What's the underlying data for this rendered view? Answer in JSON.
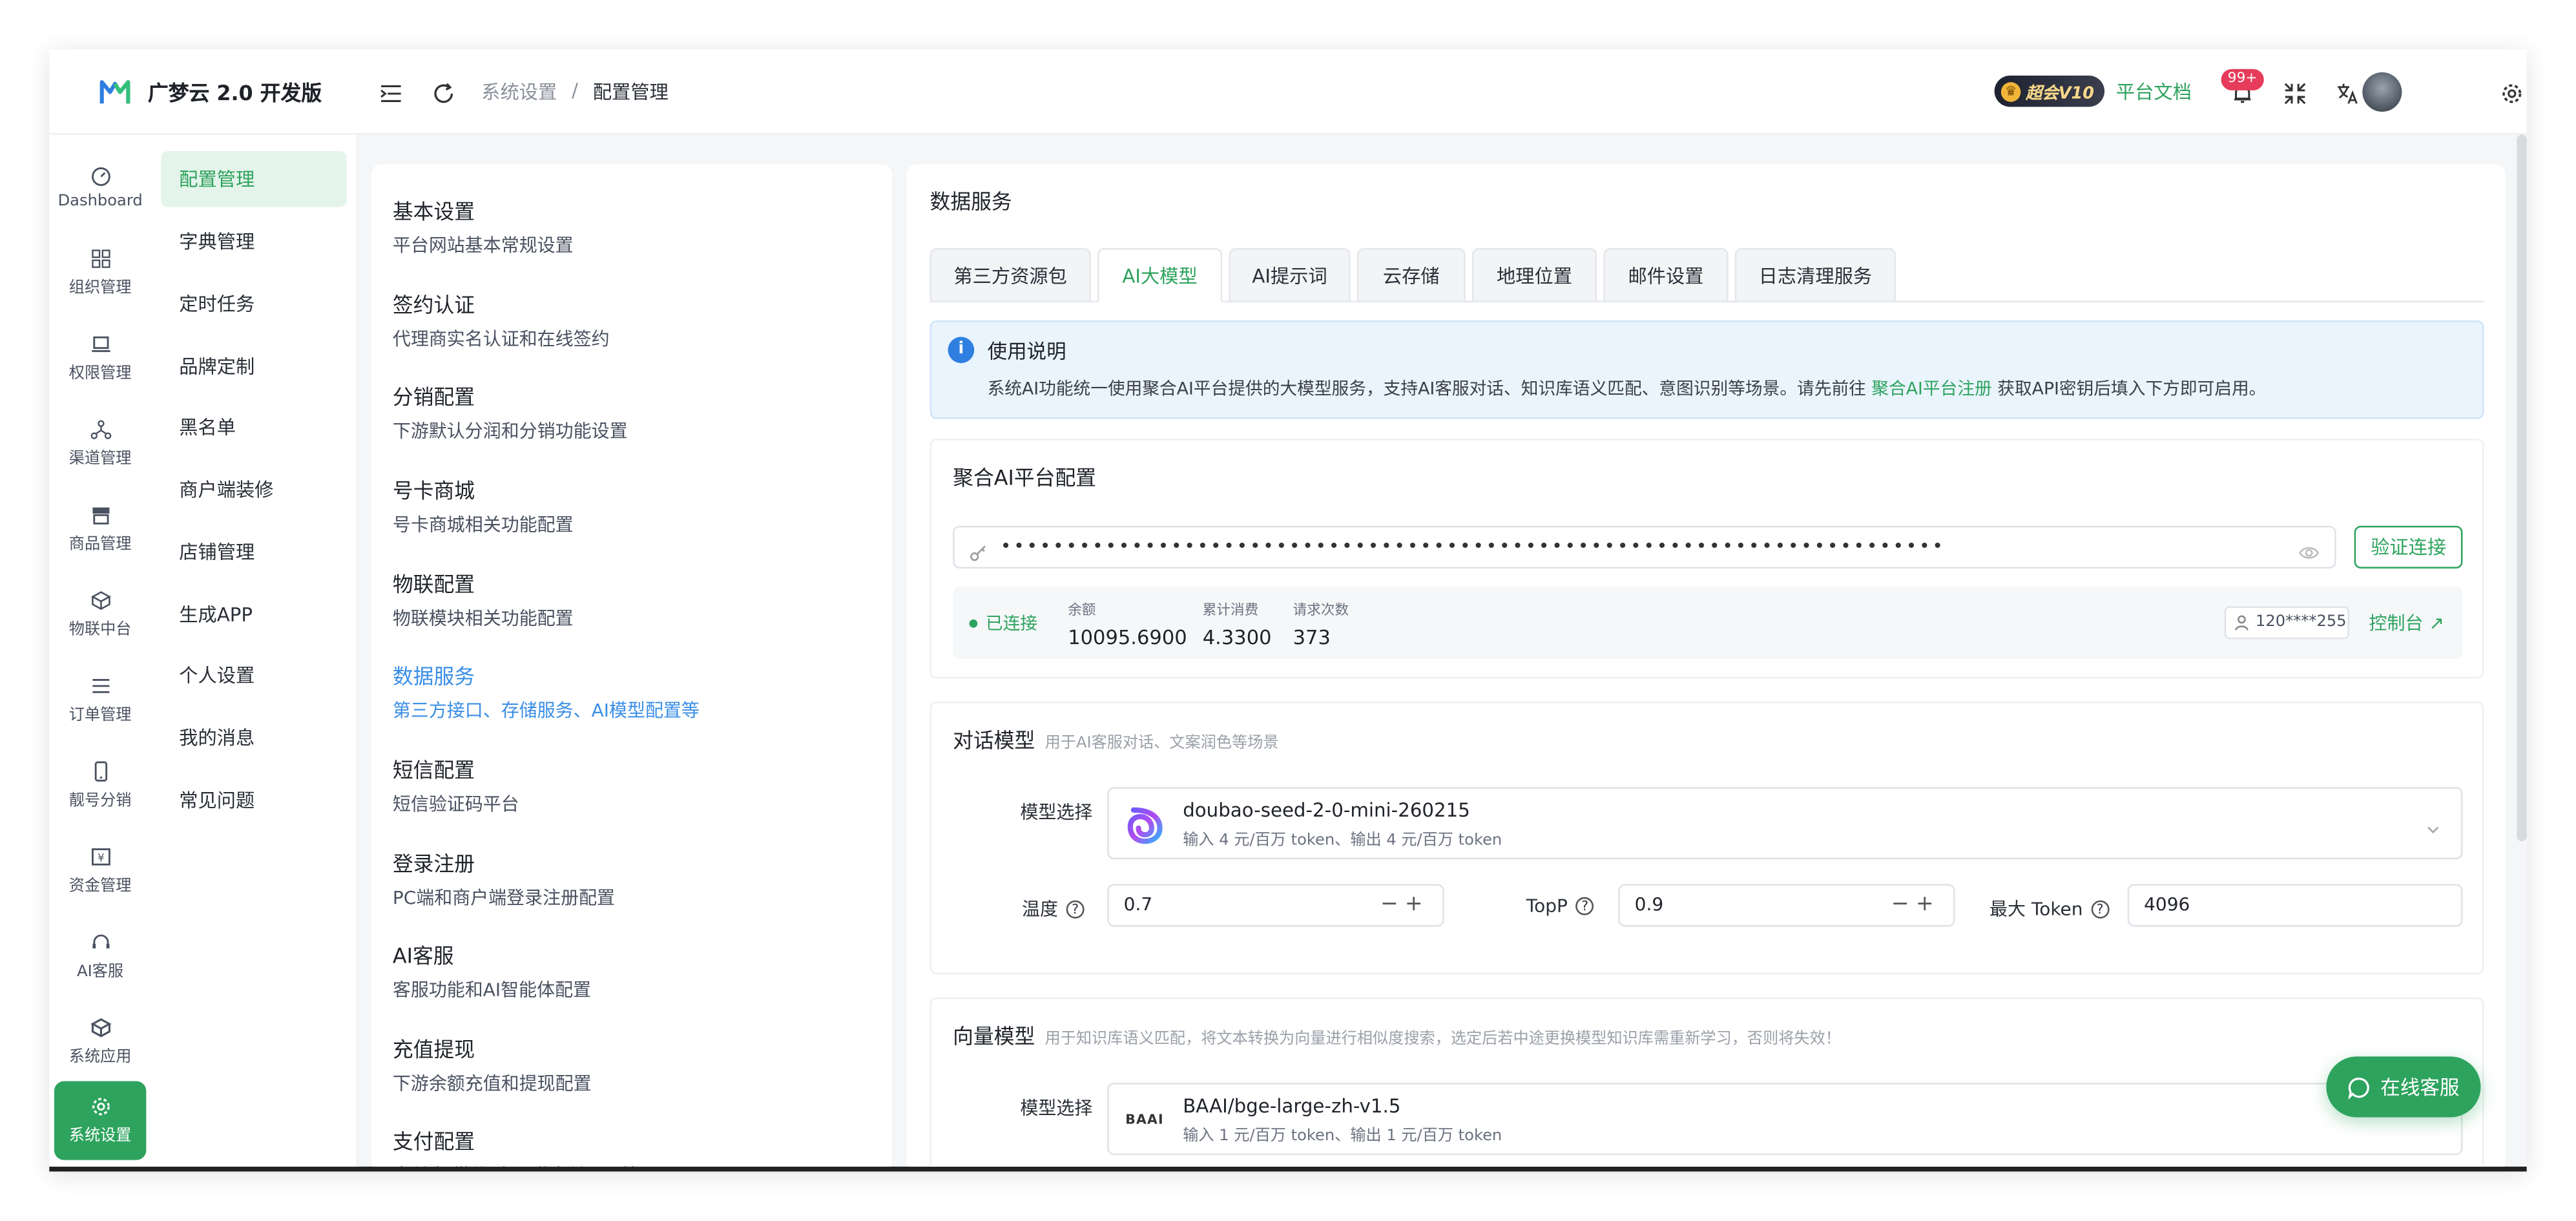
{
  "brand": {
    "name": "广梦云 2.0 开发版"
  },
  "colors": {
    "accent": "#2ea35e",
    "link_blue": "#3a8ee6",
    "badge_red": "#e63b5a"
  },
  "rail": [
    {
      "label": "Dashboard",
      "icon": "gauge-icon"
    },
    {
      "label": "组织管理",
      "icon": "grid-icon"
    },
    {
      "label": "权限管理",
      "icon": "laptop-icon"
    },
    {
      "label": "渠道管理",
      "icon": "network-icon"
    },
    {
      "label": "商品管理",
      "icon": "store-icon"
    },
    {
      "label": "物联中台",
      "icon": "cube-icon"
    },
    {
      "label": "订单管理",
      "icon": "list-icon"
    },
    {
      "label": "靓号分销",
      "icon": "phone-icon"
    },
    {
      "label": "资金管理",
      "icon": "wallet-icon"
    },
    {
      "label": "AI客服",
      "icon": "headset-icon"
    },
    {
      "label": "系统应用",
      "icon": "box-icon"
    },
    {
      "label": "系统设置",
      "icon": "gear-icon",
      "active": true
    }
  ],
  "submenu": [
    "配置管理",
    "字典管理",
    "定时任务",
    "品牌定制",
    "黑名单",
    "商户端装修",
    "店铺管理",
    "生成APP",
    "个人设置",
    "我的消息",
    "常见问题"
  ],
  "header": {
    "breadcrumb": [
      "系统设置",
      "/",
      "配置管理"
    ],
    "vip": "超会V10",
    "docs": "平台文档",
    "badge": "99+"
  },
  "categories": [
    {
      "title": "基本设置",
      "desc": "平台网站基本常规设置"
    },
    {
      "title": "签约认证",
      "desc": "代理商实名认证和在线签约"
    },
    {
      "title": "分销配置",
      "desc": "下游默认分润和分销功能设置"
    },
    {
      "title": "号卡商城",
      "desc": "号卡商城相关功能配置"
    },
    {
      "title": "物联配置",
      "desc": "物联模块相关功能配置"
    },
    {
      "title": "数据服务",
      "desc": "第三方接口、存储服务、AI模型配置等",
      "active": true
    },
    {
      "title": "短信配置",
      "desc": "短信验证码平台"
    },
    {
      "title": "登录注册",
      "desc": "PC端和商户端登录注册配置"
    },
    {
      "title": "AI客服",
      "desc": "客服功能和AI智能体配置"
    },
    {
      "title": "充值提现",
      "desc": "下游余额充值和提现配置"
    },
    {
      "title": "支付配置",
      "desc": "支付宝/微信/多通道支付配置等"
    }
  ],
  "main": {
    "title": "数据服务",
    "tabs": [
      "第三方资源包",
      "AI大模型",
      "AI提示词",
      "云存储",
      "地理位置",
      "邮件设置",
      "日志清理服务"
    ],
    "active_tab": 1,
    "notice": {
      "title": "使用说明",
      "text_before": "系统AI功能统一使用聚合AI平台提供的大模型服务，支持AI客服对话、知识库语义匹配、意图识别等场景。请先前往",
      "link": "聚合AI平台注册",
      "text_after": "获取API密钥后填入下方即可启用。"
    },
    "platform": {
      "title": "聚合AI平台配置",
      "key_mask": "••••••••••••••••••••••••••••••••••••••••••••••••••••••••••••••••••••••••",
      "verify_label": "验证连接",
      "status": "已连接",
      "stats": [
        {
          "label": "余额",
          "value": "10095.6900"
        },
        {
          "label": "累计消费",
          "value": "4.3300"
        },
        {
          "label": "请求次数",
          "value": "373"
        }
      ],
      "account": "120****255",
      "console": "控制台 ↗"
    },
    "chat_model": {
      "title": "对话模型",
      "subtitle": "用于AI客服对话、文案润色等场景",
      "select_label": "模型选择",
      "model_name": "doubao-seed-2-0-mini-260215",
      "model_price": "输入 4 元/百万 token、输出 4 元/百万 token",
      "temp_label": "温度",
      "temp_value": "0.7",
      "topp_label": "TopP",
      "topp_value": "0.9",
      "maxtoken_label": "最大 Token",
      "maxtoken_value": "4096"
    },
    "vector_model": {
      "title": "向量模型",
      "subtitle": "用于知识库语义匹配，将文本转换为向量进行相似度搜索，选定后若中途更换模型知识库需重新学习，否则将失效！",
      "select_label": "模型选择",
      "model_name": "BAAI/bge-large-zh-v1.5",
      "model_price": "输入 1 元/百万 token、输出 1 元/百万 token",
      "logo_text": "BAAI"
    }
  },
  "chat_button": "在线客服"
}
